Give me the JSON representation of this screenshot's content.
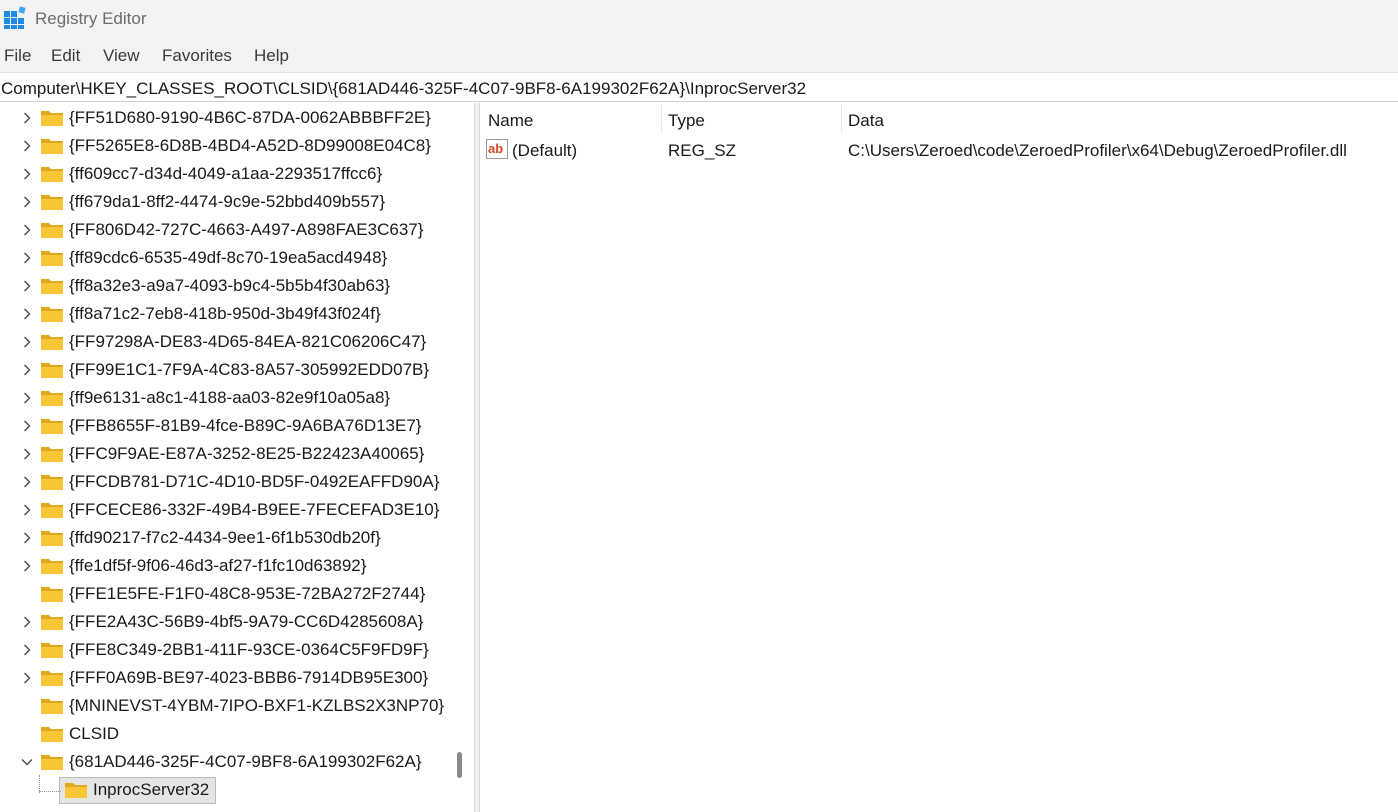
{
  "window": {
    "title": "Registry Editor"
  },
  "menu": {
    "items": [
      "File",
      "Edit",
      "View",
      "Favorites",
      "Help"
    ]
  },
  "address": {
    "path": "Computer\\HKEY_CLASSES_ROOT\\CLSID\\{681AD446-325F-4C07-9BF8-6A199302F62A}\\InprocServer32"
  },
  "tree": {
    "items": [
      {
        "label": "{FF51D680-9190-4B6C-87DA-0062ABBBFF2E}",
        "expandable": true
      },
      {
        "label": "{FF5265E8-6D8B-4BD4-A52D-8D99008E04C8}",
        "expandable": true
      },
      {
        "label": "{ff609cc7-d34d-4049-a1aa-2293517ffcc6}",
        "expandable": true
      },
      {
        "label": "{ff679da1-8ff2-4474-9c9e-52bbd409b557}",
        "expandable": true
      },
      {
        "label": "{FF806D42-727C-4663-A497-A898FAE3C637}",
        "expandable": true
      },
      {
        "label": "{ff89cdc6-6535-49df-8c70-19ea5acd4948}",
        "expandable": true
      },
      {
        "label": "{ff8a32e3-a9a7-4093-b9c4-5b5b4f30ab63}",
        "expandable": true
      },
      {
        "label": "{ff8a71c2-7eb8-418b-950d-3b49f43f024f}",
        "expandable": true
      },
      {
        "label": "{FF97298A-DE83-4D65-84EA-821C06206C47}",
        "expandable": true
      },
      {
        "label": "{FF99E1C1-7F9A-4C83-8A57-305992EDD07B}",
        "expandable": true
      },
      {
        "label": "{ff9e6131-a8c1-4188-aa03-82e9f10a05a8}",
        "expandable": true
      },
      {
        "label": "{FFB8655F-81B9-4fce-B89C-9A6BA76D13E7}",
        "expandable": true
      },
      {
        "label": "{FFC9F9AE-E87A-3252-8E25-B22423A40065}",
        "expandable": true
      },
      {
        "label": "{FFCDB781-D71C-4D10-BD5F-0492EAFFD90A}",
        "expandable": true
      },
      {
        "label": "{FFCECE86-332F-49B4-B9EE-7FECEFAD3E10}",
        "expandable": true
      },
      {
        "label": "{ffd90217-f7c2-4434-9ee1-6f1b530db20f}",
        "expandable": true
      },
      {
        "label": "{ffe1df5f-9f06-46d3-af27-f1fc10d63892}",
        "expandable": true
      },
      {
        "label": "{FFE1E5FE-F1F0-48C8-953E-72BA272F2744}",
        "expandable": false
      },
      {
        "label": "{FFE2A43C-56B9-4bf5-9A79-CC6D4285608A}",
        "expandable": true
      },
      {
        "label": "{FFE8C349-2BB1-411F-93CE-0364C5F9FD9F}",
        "expandable": true
      },
      {
        "label": "{FFF0A69B-BE97-4023-BBB6-7914DB95E300}",
        "expandable": true
      },
      {
        "label": "{MNINEVST-4YBM-7IPO-BXF1-KZLBS2X3NP70}",
        "expandable": false
      },
      {
        "label": "CLSID",
        "expandable": false
      },
      {
        "label": "{681AD446-325F-4C07-9BF8-6A199302F62A}",
        "expandable": true,
        "expanded": true
      },
      {
        "label": "InprocServer32",
        "expandable": false,
        "selected": true,
        "child": true
      }
    ]
  },
  "list": {
    "columns": [
      "Name",
      "Type",
      "Data"
    ],
    "rows": [
      {
        "name": "(Default)",
        "type": "REG_SZ",
        "data": "C:\\Users\\Zeroed\\code\\ZeroedProfiler\\x64\\Debug\\ZeroedProfiler.dll",
        "icon": "string-value-icon"
      }
    ]
  },
  "colors": {
    "folder": "#f8c537",
    "folder_dark": "#e0a820",
    "ab_icon": "#d2462a",
    "chrome": "#f3f3f3"
  }
}
